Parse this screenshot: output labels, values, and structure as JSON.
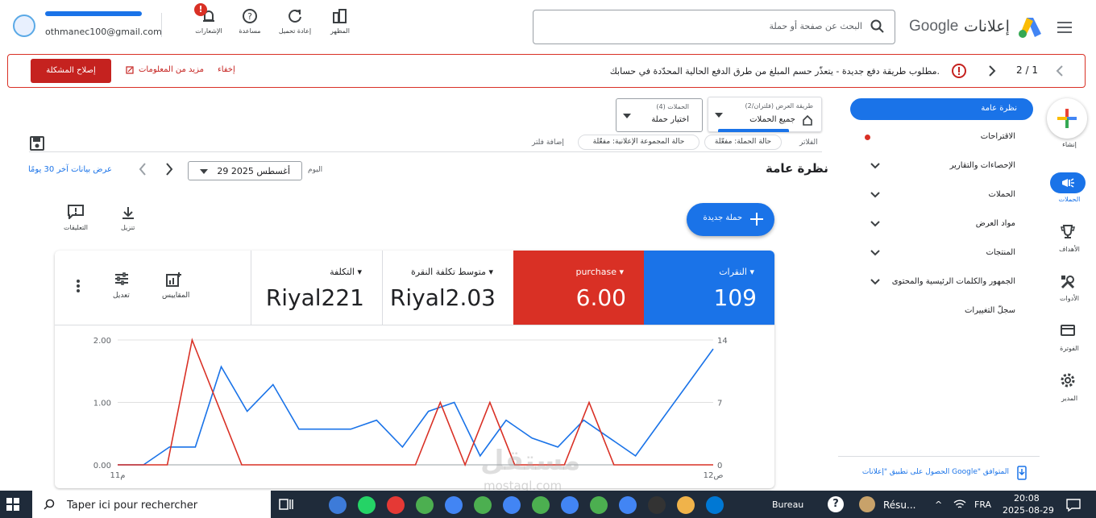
{
  "header": {
    "product": "إعلانات",
    "google": "Google",
    "search_placeholder": "البحث عن صفحة أو حملة",
    "tools": [
      {
        "label": "المظهر",
        "icon": "appearance-icon"
      },
      {
        "label": "إعادة تحميل",
        "icon": "refresh-icon"
      },
      {
        "label": "مساعدة",
        "icon": "help-icon"
      },
      {
        "label": "الإشعارات",
        "icon": "bell-icon",
        "badge": "!"
      }
    ],
    "account_email": "othmanec100@gmail.com"
  },
  "alert": {
    "pager": "2 / 1",
    "message": "مطلوب طريقة دفع جديدة - يتعذّر حسم المبلغ من طرق الدفع الحالية المحدّدة في حسابك.",
    "hide": "إخفاء",
    "more_info": "مزيد من المعلومات",
    "fix": "إصلاح المشكلة"
  },
  "nav": {
    "overview": "نظرة عامة",
    "items": [
      "الاقتراحات",
      "الإحصاءات والتقارير",
      "الحملات",
      "مواد العرض",
      "المنتجات",
      "الجمهور والكلمات الرئيسية والمحتوى",
      "سجلّ التغييرات"
    ],
    "app_promo": "الحصول على تطبيق \"إعلانات Google\" المتوافق"
  },
  "rail": [
    {
      "label": "إنشاء",
      "icon": "plus-icon"
    },
    {
      "label": "الحملات",
      "icon": "megaphone-icon"
    },
    {
      "label": "الأهداف",
      "icon": "trophy-icon"
    },
    {
      "label": "الأدوات",
      "icon": "tools-icon"
    },
    {
      "label": "الفوترة",
      "icon": "card-icon"
    },
    {
      "label": "المدير",
      "icon": "gear-icon"
    }
  ],
  "selectors": {
    "view_label": "طريقة العرض (فلتران/2)",
    "view_value": "جميع الحملات",
    "campaigns_label": "الحملات (4)",
    "campaigns_value": "اختيار حملة"
  },
  "filters": {
    "label": "الفلاتر",
    "chips": [
      "حالة الحملة: مفعّلة",
      "حالة المجموعة الإعلانية: مفعّلة"
    ],
    "add": "إضافة فلتر"
  },
  "page": {
    "title": "نظرة عامة",
    "date_prefix": "اليوم",
    "date": "29 أغسطس 2025",
    "last30": "عرض بيانات آخر 30 يومًا",
    "download": "تنزيل",
    "comments": "التعليقات",
    "new_campaign": "حملة جديدة"
  },
  "metrics": [
    {
      "label": "النقرات",
      "value": "109",
      "color": "#1a73e8"
    },
    {
      "label": "purchase",
      "value": "6.00",
      "color": "#d93025"
    },
    {
      "label": "متوسط تكلفة النقرة",
      "value": "Riyal2.03"
    },
    {
      "label": "التكلفة",
      "value": "Riyal221"
    }
  ],
  "card_tools": {
    "metrics": "المقاييس",
    "edit": "تعديل"
  },
  "chart_data": {
    "type": "line",
    "x_start_label": "11م",
    "x_end_label": "12ص",
    "left_axis": {
      "ticks": [
        "2.00",
        "1.00",
        "0.00"
      ],
      "ylim": [
        0,
        2
      ]
    },
    "right_axis": {
      "ticks": [
        "14",
        "7",
        "0"
      ],
      "ylim": [
        0,
        14
      ]
    },
    "series": [
      {
        "name": "النقرات",
        "axis": "right",
        "color": "#1a73e8",
        "values": [
          0,
          0,
          2,
          2,
          11,
          6,
          9,
          4,
          4,
          4,
          5,
          2,
          6,
          7,
          1,
          5,
          3,
          2,
          5,
          3,
          1,
          5,
          9,
          13
        ]
      },
      {
        "name": "purchase",
        "axis": "left",
        "color": "#d93025",
        "values": [
          0,
          0,
          0,
          2,
          1,
          0,
          0,
          0,
          0,
          0,
          0,
          0,
          0,
          1,
          0,
          1,
          0,
          0,
          0,
          1,
          0,
          0,
          0,
          0,
          0
        ]
      }
    ]
  },
  "taskbar": {
    "search": "Taper ici pour rechercher",
    "bureau": "Bureau",
    "resume": "Résu...",
    "lang": "FRA",
    "time": "20:08",
    "date": "2025-08-29"
  },
  "watermark": {
    "text": "مستقل",
    "sub": "mostaql.com"
  }
}
